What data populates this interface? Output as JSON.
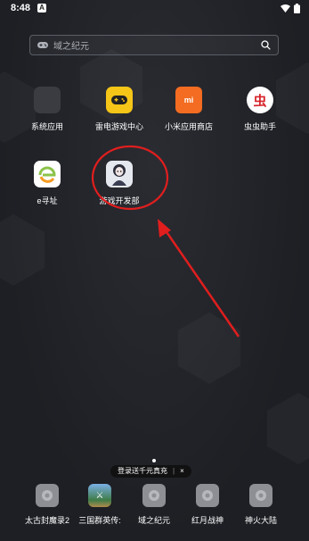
{
  "status_bar": {
    "time": "8:48",
    "notification_badge": "A",
    "icons": [
      "wifi-icon",
      "battery-icon"
    ]
  },
  "search": {
    "placeholder": "域之纪元",
    "left_icon": "gamepad-icon",
    "right_icon": "search-icon"
  },
  "apps": [
    {
      "label": "系统应用",
      "icon": "folder-icon"
    },
    {
      "label": "雷电游戏中心",
      "icon": "gamepad-icon"
    },
    {
      "label": "小米应用商店",
      "icon": "mi-store-icon"
    },
    {
      "label": "虫虫助手",
      "icon": "chongchong-icon"
    },
    {
      "label": "e寻址",
      "icon": "e-icon"
    },
    {
      "label": "游戏开发部",
      "icon": "game-dev-icon"
    }
  ],
  "toast": {
    "text": "登录送千元真充",
    "separator": "|",
    "close": "×"
  },
  "dock": [
    {
      "label": "太古封魔录2",
      "icon": "placeholder-app-icon"
    },
    {
      "label": "三国群英传:",
      "icon": "sanguo-icon"
    },
    {
      "label": "域之纪元",
      "icon": "placeholder-app-icon"
    },
    {
      "label": "红月战神",
      "icon": "placeholder-app-icon"
    },
    {
      "label": "神火大陆",
      "icon": "placeholder-app-icon"
    }
  ],
  "annotation": {
    "color": "#e01e1e"
  }
}
